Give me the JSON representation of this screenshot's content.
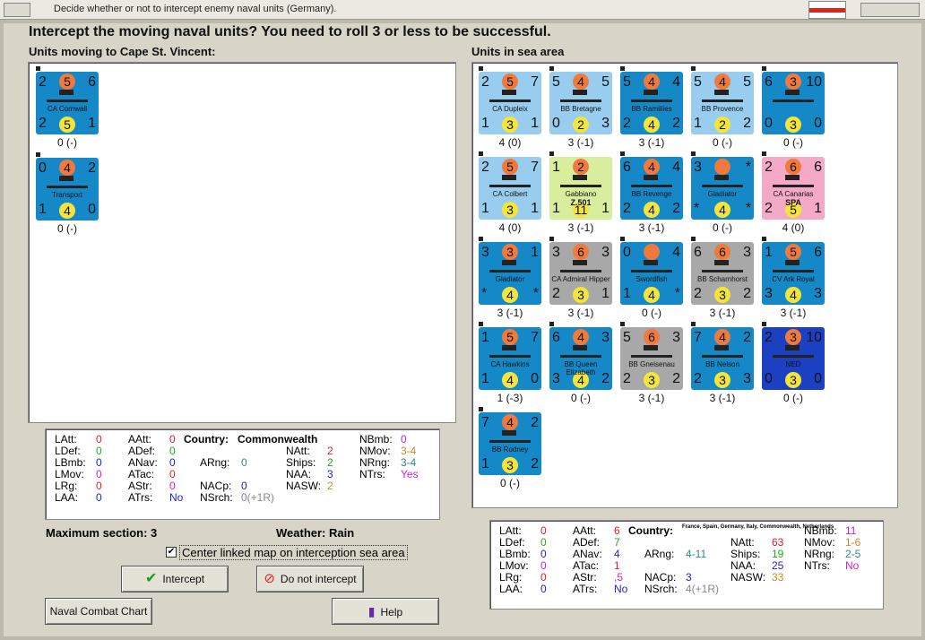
{
  "window": {
    "title": "Decide whether or not to intercept enemy naval units (Germany)."
  },
  "headline": "Intercept the moving naval units?  You need to roll 3 or less to be successful.",
  "left_title": "Units moving to Cape St. Vincent:",
  "right_title": "Units in sea area",
  "moving_units": [
    {
      "tl": "2",
      "att": "5",
      "tr": "6",
      "name": "CA Cornwall",
      "bl": "2",
      "def": "5",
      "br": "1",
      "label": "0 (-)"
    },
    {
      "tl": "0",
      "att": "4",
      "tr": "2",
      "name": "Transport",
      "bl": "1",
      "def": "4",
      "br": "0",
      "label": "0 (-)"
    }
  ],
  "sea_units": [
    {
      "tl": "2",
      "att": "5",
      "tr": "7",
      "name": "CA Dupleix",
      "bl": "1",
      "def": "3",
      "br": "1",
      "label": "4 (0)",
      "color": "lb"
    },
    {
      "tl": "5",
      "att": "4",
      "tr": "5",
      "name": "BB Bretagne",
      "bl": "0",
      "def": "2",
      "br": "3",
      "label": "3 (-1)",
      "color": "lb"
    },
    {
      "tl": "5",
      "att": "4",
      "tr": "4",
      "name": "BB Ramillies",
      "bl": "2",
      "def": "4",
      "br": "2",
      "label": "3 (-1)",
      "color": "blue"
    },
    {
      "tl": "5",
      "att": "4",
      "tr": "5",
      "name": "BB Provence",
      "bl": "1",
      "def": "2",
      "br": "2",
      "label": "0 (-)",
      "color": "lb"
    },
    {
      "tl": "6",
      "att": "3",
      "tr": "10",
      "name": "",
      "bl": "0",
      "def": "3",
      "br": "0",
      "label": "0 (-)",
      "color": "blue"
    },
    {
      "tl": "2",
      "att": "5",
      "tr": "7",
      "name": "CA Colbert",
      "bl": "1",
      "def": "3",
      "br": "1",
      "label": "4 (0)",
      "color": "lb"
    },
    {
      "tl": "1",
      "att": "2",
      "tr": "",
      "name": "Gabbiano",
      "bl": "1",
      "def": "11",
      "br": "1",
      "label": "3 (-1)",
      "color": "y",
      "sub": "Z.501"
    },
    {
      "tl": "6",
      "att": "4",
      "tr": "4",
      "name": "BB Revenge",
      "bl": "2",
      "def": "4",
      "br": "2",
      "label": "3 (-1)",
      "color": "blue"
    },
    {
      "tl": "3",
      "att": "",
      "tr": "*",
      "name": "Gladiator",
      "bl": "*",
      "def": "4",
      "br": "*",
      "label": "0 (-)",
      "color": "blue"
    },
    {
      "tl": "2",
      "att": "6",
      "tr": "6",
      "name": "CA Canarias",
      "bl": "2",
      "def": "5",
      "br": "1",
      "label": "4 (0)",
      "color": "pk",
      "sub": "SPA"
    },
    {
      "tl": "3",
      "att": "3",
      "tr": "1",
      "name": "Gladiator",
      "bl": "*",
      "def": "4",
      "br": "*",
      "label": "3 (-1)",
      "color": "blue"
    },
    {
      "tl": "3",
      "att": "6",
      "tr": "3",
      "name": "CA Admiral Hipper",
      "bl": "2",
      "def": "3",
      "br": "1",
      "label": "3 (-1)",
      "color": "gr"
    },
    {
      "tl": "0",
      "att": "",
      "tr": "4",
      "name": "Swordfish",
      "bl": "1",
      "def": "4",
      "br": "*",
      "label": "0 (-)",
      "color": "blue"
    },
    {
      "tl": "6",
      "att": "6",
      "tr": "3",
      "name": "BB Scharnhorst",
      "bl": "2",
      "def": "3",
      "br": "2",
      "label": "3 (-1)",
      "color": "gr"
    },
    {
      "tl": "1",
      "att": "5",
      "tr": "6",
      "name": "CV Ark Royal",
      "bl": "3",
      "def": "4",
      "br": "3",
      "label": "3 (-1)",
      "color": "blue"
    },
    {
      "tl": "1",
      "att": "5",
      "tr": "7",
      "name": "CA Hawkins",
      "bl": "1",
      "def": "4",
      "br": "0",
      "label": "1 (-3)",
      "color": "blue"
    },
    {
      "tl": "6",
      "att": "4",
      "tr": "3",
      "name": "BB Queen Elizabeth",
      "bl": "3",
      "def": "4",
      "br": "2",
      "label": "0 (-)",
      "color": "blue"
    },
    {
      "tl": "5",
      "att": "6",
      "tr": "3",
      "name": "BB Gneisenau",
      "bl": "2",
      "def": "3",
      "br": "2",
      "label": "3 (-1)",
      "color": "gr"
    },
    {
      "tl": "7",
      "att": "4",
      "tr": "2",
      "name": "BB Nelson",
      "bl": "2",
      "def": "3",
      "br": "3",
      "label": "3 (-1)",
      "color": "blue"
    },
    {
      "tl": "2",
      "att": "3",
      "tr": "10",
      "name": "NED",
      "bl": "0",
      "def": "3",
      "br": "0",
      "label": "0 (-)",
      "color": "ned"
    },
    {
      "tl": "7",
      "att": "4",
      "tr": "2",
      "name": "BB Rodney",
      "bl": "1",
      "def": "3",
      "br": "2",
      "label": "0 (-)",
      "color": "blue"
    }
  ],
  "left_stats": {
    "latt": "LAtt:",
    "latt_v": "0",
    "ldef": "LDef:",
    "ldef_v": "0",
    "lbmb": "LBmb:",
    "lbmb_v": "0",
    "lmov": "LMov:",
    "lmov_v": "0",
    "lrg": "LRg:",
    "lrg_v": "0",
    "laa": "LAA:",
    "laa_v": "0",
    "aatt": "AAtt:",
    "aatt_v": "0",
    "adef": "ADef:",
    "adef_v": "0",
    "anav": "ANav:",
    "anav_v": "0",
    "atac": "ATac:",
    "atac_v": "0",
    "astr": "AStr:",
    "astr_v": "0",
    "atrs": "ATrs:",
    "atrs_v": "No",
    "country": "Country:",
    "country_v": "Commonwealth",
    "arng": "ARng:",
    "arng_v": "0",
    "nacp": "NACp:",
    "nacp_v": "0",
    "nsrch": "NSrch:",
    "nsrch_v": "0(+1R)",
    "natt": "NAtt:",
    "natt_v": "2",
    "ships": "Ships:",
    "ships_v": "2",
    "naa": "NAA:",
    "naa_v": "3",
    "nasw": "NASW:",
    "nasw_v": "2",
    "nbmb": "NBmb:",
    "nbmb_v": "0",
    "nmov": "NMov:",
    "nmov_v": "3-4",
    "nrng": "NRng:",
    "nrng_v": "3-4",
    "ntrs": "NTrs:",
    "ntrs_v": "Yes"
  },
  "right_stats": {
    "latt": "LAtt:",
    "latt_v": "0",
    "ldef": "LDef:",
    "ldef_v": "0",
    "lbmb": "LBmb:",
    "lbmb_v": "0",
    "lmov": "LMov:",
    "lmov_v": "0",
    "lrg": "LRg:",
    "lrg_v": "0",
    "laa": "LAA:",
    "laa_v": "0",
    "aatt": "AAtt:",
    "aatt_v": "6",
    "adef": "ADef:",
    "adef_v": "7",
    "anav": "ANav:",
    "anav_v": "4",
    "atac": "ATac:",
    "atac_v": "1",
    "astr": "AStr:",
    "astr_v": ",5",
    "atrs": "ATrs:",
    "atrs_v": "No",
    "country": "Country:",
    "country_v": "France, Spain, Germany, Italy, Commonwealth, Netherlands",
    "arng": "ARng:",
    "arng_v": "4-11",
    "nacp": "NACp:",
    "nacp_v": "3",
    "nsrch": "NSrch:",
    "nsrch_v": "4(+1R)",
    "natt": "NAtt:",
    "natt_v": "63",
    "ships": "Ships:",
    "ships_v": "19",
    "naa": "NAA:",
    "naa_v": "25",
    "nasw": "NASW:",
    "nasw_v": "33",
    "nbmb": "NBmb:",
    "nbmb_v": "11",
    "nmov": "NMov:",
    "nmov_v": "1-6",
    "nrng": "NRng:",
    "nrng_v": "2-5",
    "ntrs": "NTrs:",
    "ntrs_v": "No"
  },
  "max_section": "Maximum section: 3",
  "weather": "Weather:  Rain",
  "center_check": "Center linked map on interception sea area",
  "buttons": {
    "intercept": "Intercept",
    "not_intercept": "Do not intercept",
    "naval_chart": "Naval Combat Chart",
    "help": "Help"
  },
  "colors": {
    "orange": "#f07a3c",
    "yellow": "#f5e53a",
    "blue": "#1589c8"
  }
}
